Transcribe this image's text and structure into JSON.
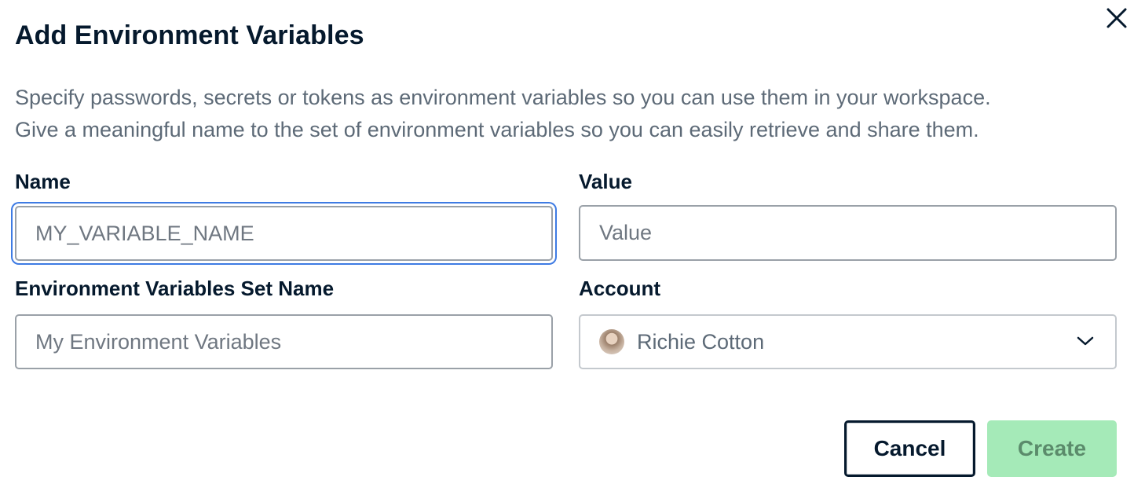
{
  "dialog": {
    "title": "Add Environment Variables",
    "description_line1": "Specify passwords, secrets or tokens as environment variables so you can use them in your workspace.",
    "description_line2": "Give a meaningful name to the set of environment variables so you can easily retrieve and share them."
  },
  "fields": {
    "name": {
      "label": "Name",
      "value": "",
      "placeholder": "MY_VARIABLE_NAME",
      "focused": true
    },
    "value": {
      "label": "Value",
      "value": "",
      "placeholder": "Value"
    },
    "set_name": {
      "label": "Environment Variables Set Name",
      "value": "",
      "placeholder": "My Environment Variables"
    },
    "account": {
      "label": "Account",
      "selected": "Richie Cotton"
    }
  },
  "buttons": {
    "cancel": "Cancel",
    "create": "Create"
  },
  "icons": {
    "close": "close-icon",
    "chevron": "chevron-down-icon",
    "avatar": "avatar"
  },
  "colors": {
    "text": "#05192d",
    "muted": "#5d6a77",
    "focus_ring": "#3e7be3",
    "create_bg": "#a5eab8",
    "create_text": "#5b8b6b"
  }
}
